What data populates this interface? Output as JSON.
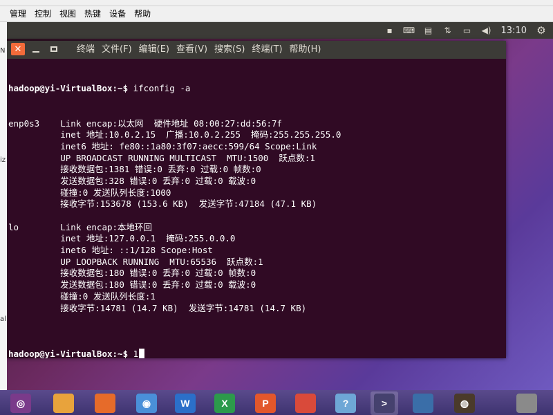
{
  "vbox_menu": [
    "管理",
    "控制",
    "视图",
    "热键",
    "设备",
    "帮助"
  ],
  "top_panel": {
    "clock": "13:10"
  },
  "terminal": {
    "menu": [
      "终端",
      "文件(F)",
      "编辑(E)",
      "查看(V)",
      "搜索(S)",
      "终端(T)",
      "帮助(H)"
    ],
    "prompt": "hadoop@yi-VirtualBox:~$",
    "command": " ifconfig -a",
    "output_lines": [
      "enp0s3    Link encap:以太网  硬件地址 08:00:27:dd:56:7f",
      "          inet 地址:10.0.2.15  广播:10.0.2.255  掩码:255.255.255.0",
      "          inet6 地址: fe80::1a80:3f07:aecc:599/64 Scope:Link",
      "          UP BROADCAST RUNNING MULTICAST  MTU:1500  跃点数:1",
      "          接收数据包:1381 错误:0 丢弃:0 过载:0 帧数:0",
      "          发送数据包:328 错误:0 丢弃:0 过载:0 载波:0",
      "          碰撞:0 发送队列长度:1000",
      "          接收字节:153678 (153.6 KB)  发送字节:47184 (47.1 KB)",
      "",
      "lo        Link encap:本地环回",
      "          inet 地址:127.0.0.1  掩码:255.0.0.0",
      "          inet6 地址: ::1/128 Scope:Host",
      "          UP LOOPBACK RUNNING  MTU:65536  跃点数:1",
      "          接收数据包:180 错误:0 丢弃:0 过载:0 帧数:0",
      "          发送数据包:180 错误:0 丢弃:0 过载:0 载波:0",
      "          碰撞:0 发送队列长度:1",
      "          接收字节:14781 (14.7 KB)  发送字节:14781 (14.7 KB)",
      ""
    ],
    "current_input": " 1"
  },
  "left_strip_text": [
    "N",
    "iz",
    "al"
  ],
  "dock_items": [
    {
      "name": "ubuntu-logo-icon",
      "color": "#7a3a8a",
      "glyph": "◎"
    },
    {
      "name": "files-icon",
      "color": "#e8a33c",
      "glyph": ""
    },
    {
      "name": "firefox-icon",
      "color": "#e66b2a",
      "glyph": ""
    },
    {
      "name": "chromium-icon",
      "color": "#4a90d9",
      "glyph": "◉"
    },
    {
      "name": "wps-writer-icon",
      "color": "#2b6fc9",
      "glyph": "W"
    },
    {
      "name": "wps-spreadsheet-icon",
      "color": "#2c9a4b",
      "glyph": "X"
    },
    {
      "name": "wps-presentation-icon",
      "color": "#e2572b",
      "glyph": "P"
    },
    {
      "name": "software-center-icon",
      "color": "#d94a3a",
      "glyph": ""
    },
    {
      "name": "user-guide-icon",
      "color": "#6ea7d6",
      "glyph": "?"
    },
    {
      "name": "terminal-icon",
      "color": "#45416e",
      "glyph": ">"
    },
    {
      "name": "workspace-switcher-icon",
      "color": "#3a6ea8",
      "glyph": ""
    },
    {
      "name": "disk-icon",
      "color": "#4a3a2a",
      "glyph": "◍"
    },
    {
      "name": "trash-icon",
      "color": "#8a8a8a",
      "glyph": ""
    }
  ]
}
